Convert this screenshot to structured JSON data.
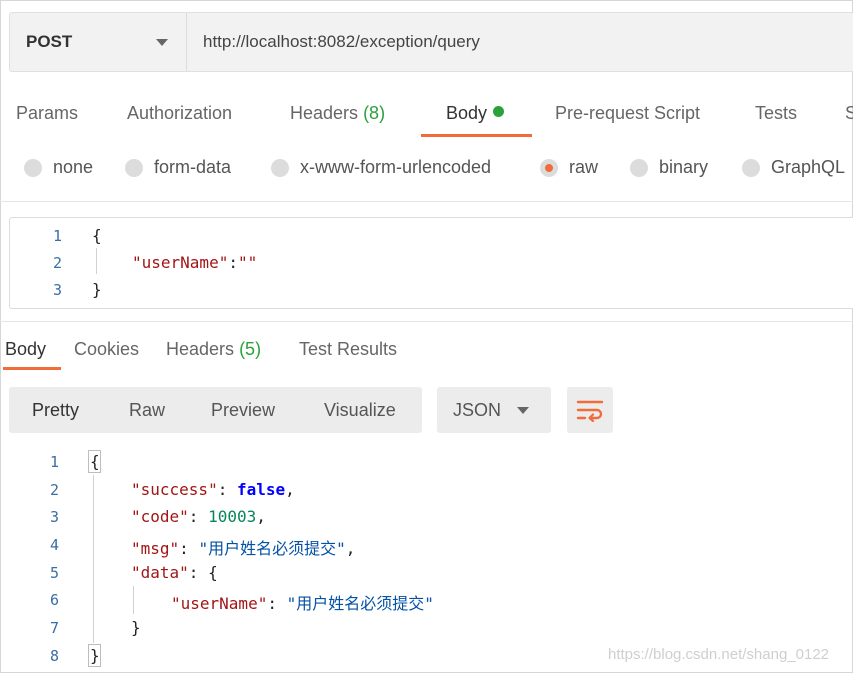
{
  "request": {
    "method": "POST",
    "url": "http://localhost:8082/exception/query"
  },
  "request_tabs": {
    "params": "Params",
    "authorization": "Authorization",
    "headers": "Headers",
    "headers_count": "(8)",
    "body": "Body",
    "pre_request": "Pre-request Script",
    "tests": "Tests",
    "settings_partial": "S"
  },
  "body_types": {
    "none": "none",
    "form_data": "form-data",
    "urlencoded": "x-www-form-urlencoded",
    "raw": "raw",
    "binary": "binary",
    "graphql": "GraphQL",
    "selected": "raw"
  },
  "request_body": {
    "line_numbers": [
      "1",
      "2",
      "3"
    ],
    "open": "{",
    "key": "\"userName\"",
    "colon": ":",
    "value": "\"\"",
    "close": "}"
  },
  "response_tabs": {
    "body": "Body",
    "cookies": "Cookies",
    "headers": "Headers",
    "headers_count": "(5)",
    "test_results": "Test Results"
  },
  "response_toolbar": {
    "pretty": "Pretty",
    "raw": "Raw",
    "preview": "Preview",
    "visualize": "Visualize",
    "format": "JSON",
    "wrap_icon": "wrap-lines-icon"
  },
  "response_body": {
    "line_numbers": [
      "1",
      "2",
      "3",
      "4",
      "5",
      "6",
      "7",
      "8"
    ],
    "open": "{",
    "success_key": "\"success\"",
    "success_val": "false",
    "code_key": "\"code\"",
    "code_val": "10003",
    "msg_key": "\"msg\"",
    "msg_val": "\"用户姓名必须提交\"",
    "data_key": "\"data\"",
    "data_open": "{",
    "user_key": "\"userName\"",
    "user_val": "\"用户姓名必须提交\"",
    "data_close": "}",
    "close": "}"
  },
  "watermark": "https://blog.csdn.net/shang_0122",
  "colors": {
    "accent": "#f26b3a",
    "count_green": "#2aa13a",
    "json_key": "#a31515",
    "json_string": "#0451a5",
    "json_number": "#098658",
    "json_bool": "#0000ff"
  }
}
